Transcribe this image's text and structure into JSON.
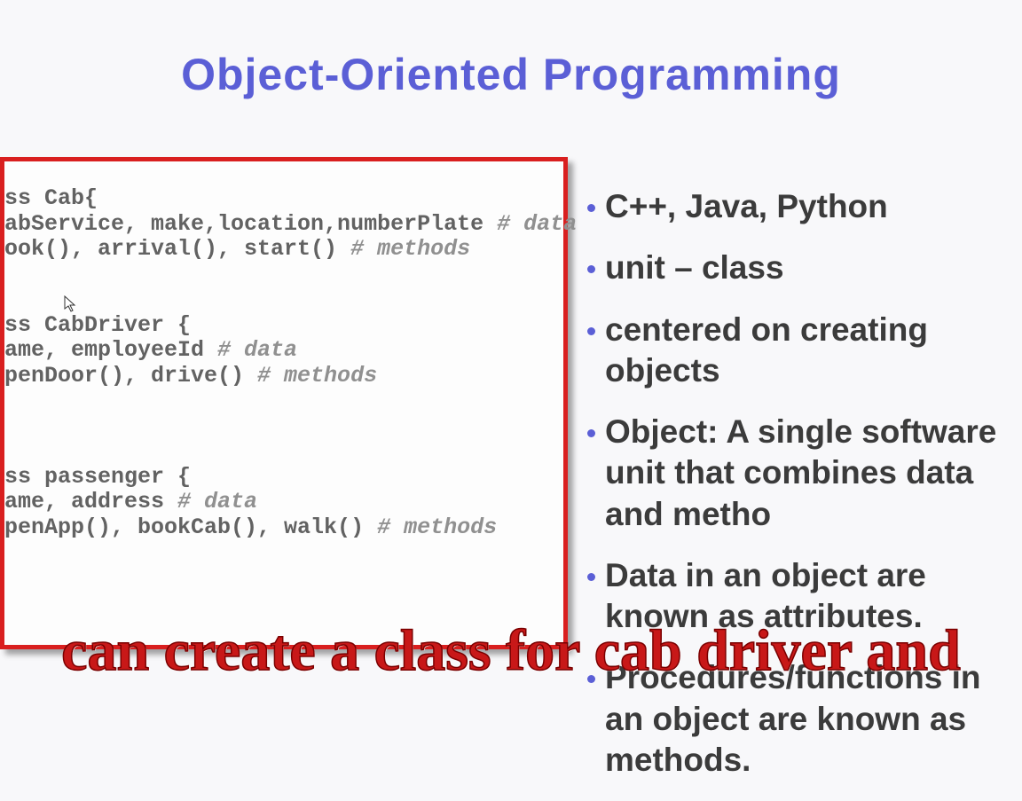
{
  "title": "Object-Oriented Programming",
  "code": {
    "block1": {
      "line1_a": "ss Cab{",
      "line2_a": "abService, make,location,numberPlate ",
      "line2_b": "# data",
      "line3_a": "ook(), arrival(), start() ",
      "line3_b": "# methods"
    },
    "block2": {
      "line1_a": "ss CabDriver {",
      "line2_a": "ame, employeeId ",
      "line2_b": "# data",
      "line3_a": "penDoor(), drive() ",
      "line3_b": "# methods"
    },
    "block3": {
      "line1_a": "ss passenger {",
      "line2_a": "ame, address ",
      "line2_b": "# data",
      "line3_a": "penApp(), bookCab(), walk() ",
      "line3_b": "# methods"
    }
  },
  "bullets": [
    "C++, Java, Python",
    "unit – class",
    "centered on creating objects",
    "Object: A single software unit that combines data and metho",
    "Data in an object are known as attributes.",
    " Procedures/functions in an object are known as methods."
  ],
  "caption": "can create a class for cab driver and"
}
